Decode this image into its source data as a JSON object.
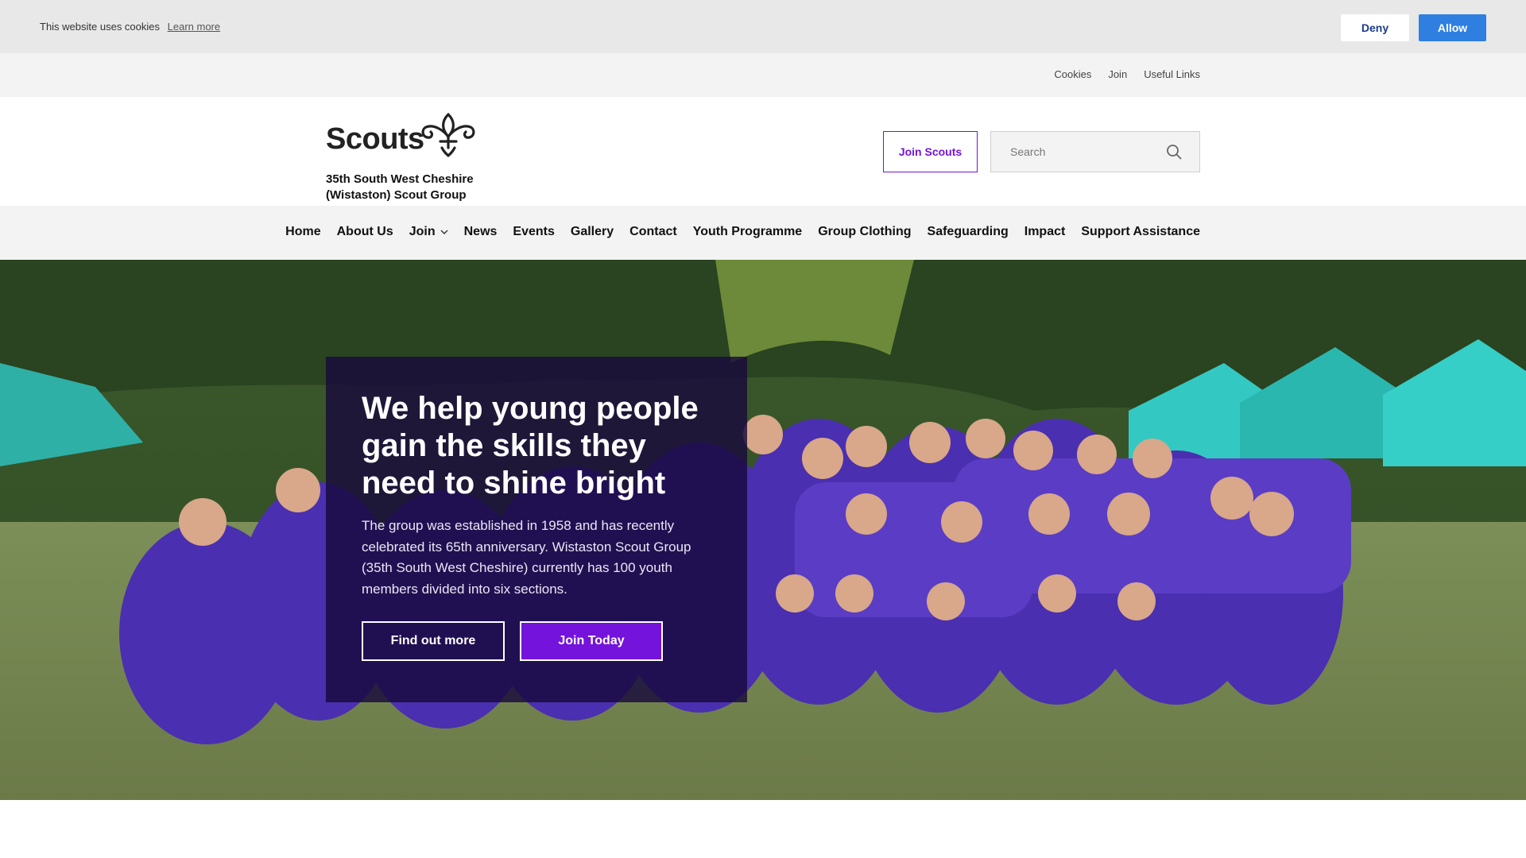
{
  "cookie_bar": {
    "message": "This website uses cookies",
    "learn_more": "Learn more",
    "deny": "Deny",
    "allow": "Allow",
    "allow_color": "#2e7fe0"
  },
  "utility_nav": {
    "items": [
      "Cookies",
      "Join",
      "Useful Links"
    ]
  },
  "header": {
    "logo_word": "Scouts",
    "logo_icon": "fleur-de-lis-icon",
    "group_name_line1": "35th South West Cheshire",
    "group_name_line2": "(Wistaston) Scout Group",
    "join_button": "Join Scouts",
    "search_placeholder": "Search",
    "brand_color": "#7413dc"
  },
  "main_nav": {
    "items": [
      "Home",
      "About Us",
      "Join",
      "News",
      "Events",
      "Gallery",
      "Contact",
      "Youth Programme",
      "Group Clothing",
      "Safeguarding",
      "Impact",
      "Support Assistance"
    ]
  },
  "hero": {
    "title": "We help young people gain the skills they need to shine bright",
    "text": "The group was established in 1958 and has recently celebrated its 65th anniversary. Wistaston Scout Group (35th South West Cheshire) currently has 100 youth members divided into six sections.",
    "primary_button": "Find out more",
    "secondary_button": "Join Today"
  }
}
